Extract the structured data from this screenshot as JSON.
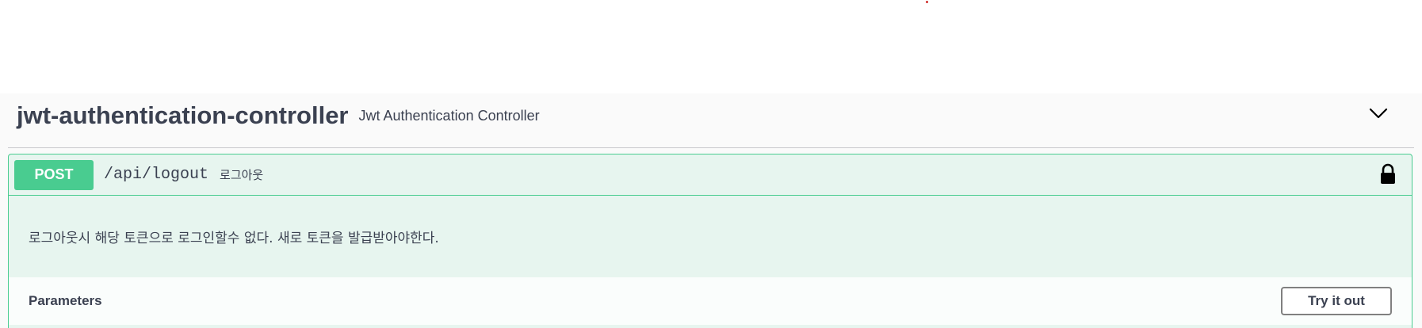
{
  "tag": {
    "name": "jwt-authentication-controller",
    "description": "Jwt Authentication Controller",
    "toggle_icon": "chevron-down-icon"
  },
  "operation": {
    "method": "POST",
    "path": "/api/logout",
    "summary": "로그아웃",
    "lock_icon": "lock-icon",
    "description": "로그아웃시 해당 토큰으로 로그인할수 없다. 새로 토큰을 발급받아야한다.",
    "accent_color": "#49cc90"
  },
  "parameters": {
    "title": "Parameters",
    "try_button_label": "Try it out"
  }
}
